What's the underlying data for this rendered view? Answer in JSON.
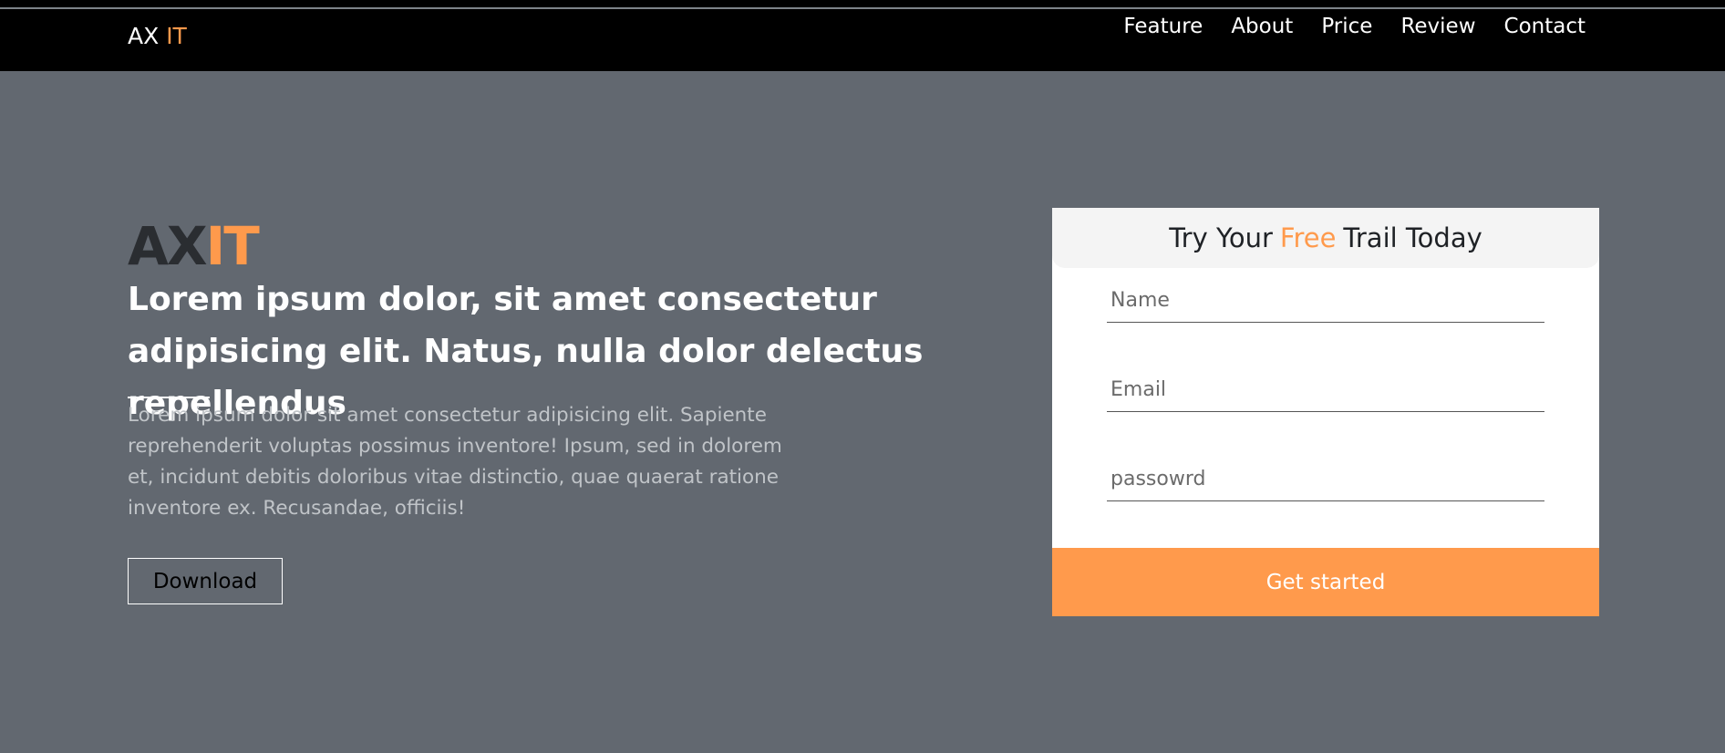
{
  "colors": {
    "accent": "#ff9a4c",
    "background": "#626870",
    "navbar": "#000000"
  },
  "navbar": {
    "brand_main": "AX",
    "brand_accent": "IT",
    "links": [
      "Feature",
      "About",
      "Price",
      "Review",
      "Contact"
    ]
  },
  "hero": {
    "logo_main": "AX",
    "logo_accent": "IT",
    "headline": "Lorem ipsum dolor, sit amet consectetur adipisicing elit. Natus, nulla dolor delectus repellendus",
    "lead": "Lorem ipsum dolor sit amet consectetur adipisicing elit. Sapiente reprehenderit voluptas possimus inventore! Ipsum, sed in dolorem et, incidunt debitis doloribus vitae distinctio, quae quaerat ratione inventore ex. Recusandae, officiis!",
    "download_label": "Download"
  },
  "signup": {
    "title_before": "Try Your",
    "title_accent": "Free",
    "title_after": "Trail Today",
    "name_placeholder": "Name",
    "email_placeholder": "Email",
    "password_placeholder": "passowrd",
    "submit_label": "Get started"
  }
}
